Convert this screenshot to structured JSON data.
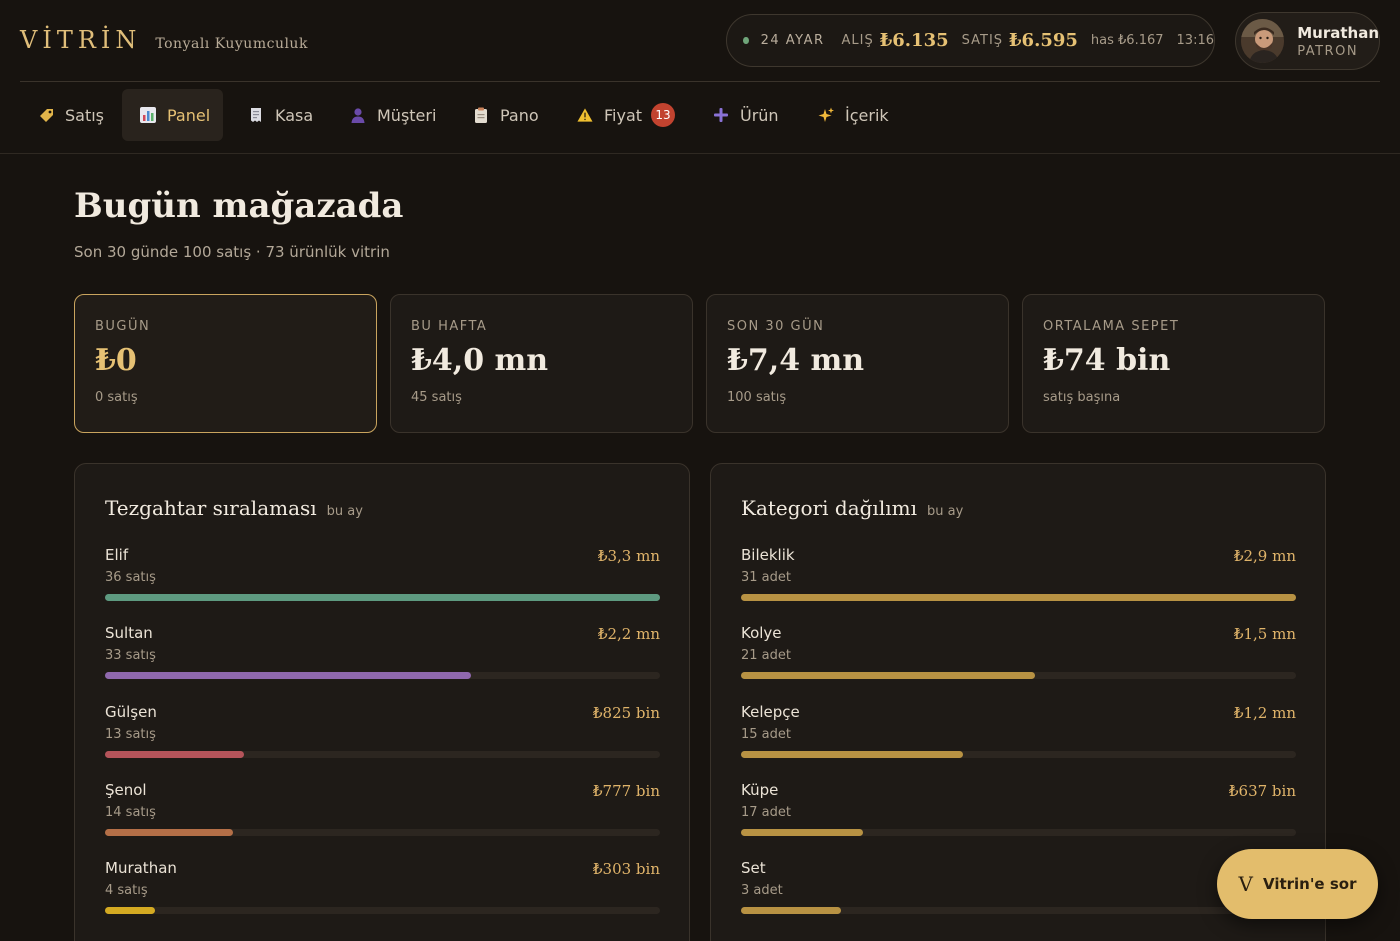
{
  "brand": {
    "logo": "VİTRİN",
    "store": "Tonyalı Kuyumculuk"
  },
  "ticker": {
    "date": "24 AYAR",
    "buy_label": "ALIŞ",
    "buy_value": "₺6.135",
    "sell_label": "SATIŞ",
    "sell_value": "₺6.595",
    "has": "has ₺6.167",
    "time": "13:16",
    "status_color": "#6fa57a"
  },
  "user": {
    "name": "Murathan",
    "role": "PATRON"
  },
  "nav": [
    {
      "label": "Satış",
      "icon": "tag-icon"
    },
    {
      "label": "Panel",
      "icon": "bar-chart-icon",
      "active": true
    },
    {
      "label": "Kasa",
      "icon": "receipt-icon"
    },
    {
      "label": "Müşteri",
      "icon": "person-icon"
    },
    {
      "label": "Pano",
      "icon": "clipboard-icon"
    },
    {
      "label": "Fiyat",
      "icon": "warning-icon",
      "badge": "13"
    },
    {
      "label": "Ürün",
      "icon": "plus-icon"
    },
    {
      "label": "İçerik",
      "icon": "sparkles-icon"
    }
  ],
  "page": {
    "title": "Bugün mağazada",
    "subtitle": "Son 30 günde 100 satış · 73 ürünlük vitrin"
  },
  "kpis": [
    {
      "label": "BUGÜN",
      "value": "₺0",
      "sub": "0 satış"
    },
    {
      "label": "BU HAFTA",
      "value": "₺4,0 mn",
      "sub": "45 satış"
    },
    {
      "label": "SON 30 GÜN",
      "value": "₺7,4 mn",
      "sub": "100 satış"
    },
    {
      "label": "ORTALAMA SEPET",
      "value": "₺74 bin",
      "sub": "satış başına"
    }
  ],
  "staff_panel": {
    "title": "Tezgahtar sıralaması",
    "period": "bu ay",
    "rows": [
      {
        "name": "Elif",
        "sub": "36 satış",
        "value": "₺3,3 mn",
        "fill": 1.0,
        "color": "#5e9a80"
      },
      {
        "name": "Sultan",
        "sub": "33 satış",
        "value": "₺2,2 mn",
        "fill": 0.66,
        "color": "#8f68ad"
      },
      {
        "name": "Gülşen",
        "sub": "13 satış",
        "value": "₺825 bin",
        "fill": 0.25,
        "color": "#b5545a"
      },
      {
        "name": "Şenol",
        "sub": "14 satış",
        "value": "₺777 bin",
        "fill": 0.23,
        "color": "#b46f47"
      },
      {
        "name": "Murathan",
        "sub": "4 satış",
        "value": "₺303 bin",
        "fill": 0.09,
        "color": "#d4aa22"
      }
    ]
  },
  "category_panel": {
    "title": "Kategori dağılımı",
    "period": "bu ay",
    "rows": [
      {
        "name": "Bileklik",
        "sub": "31 adet",
        "value": "₺2,9 mn",
        "fill": 1.0,
        "color": "#b89243"
      },
      {
        "name": "Kolye",
        "sub": "21 adet",
        "value": "₺1,5 mn",
        "fill": 0.53,
        "color": "#b89243"
      },
      {
        "name": "Kelepçe",
        "sub": "15 adet",
        "value": "₺1,2 mn",
        "fill": 0.4,
        "color": "#b89243"
      },
      {
        "name": "Küpe",
        "sub": "17 adet",
        "value": "₺637 bin",
        "fill": 0.22,
        "color": "#b89243"
      },
      {
        "name": "Set",
        "sub": "3 adet",
        "value": "",
        "fill": 0.18,
        "color": "#b89243"
      }
    ]
  },
  "assistant": {
    "logo": "V",
    "label": "Vitrin'e sor"
  }
}
